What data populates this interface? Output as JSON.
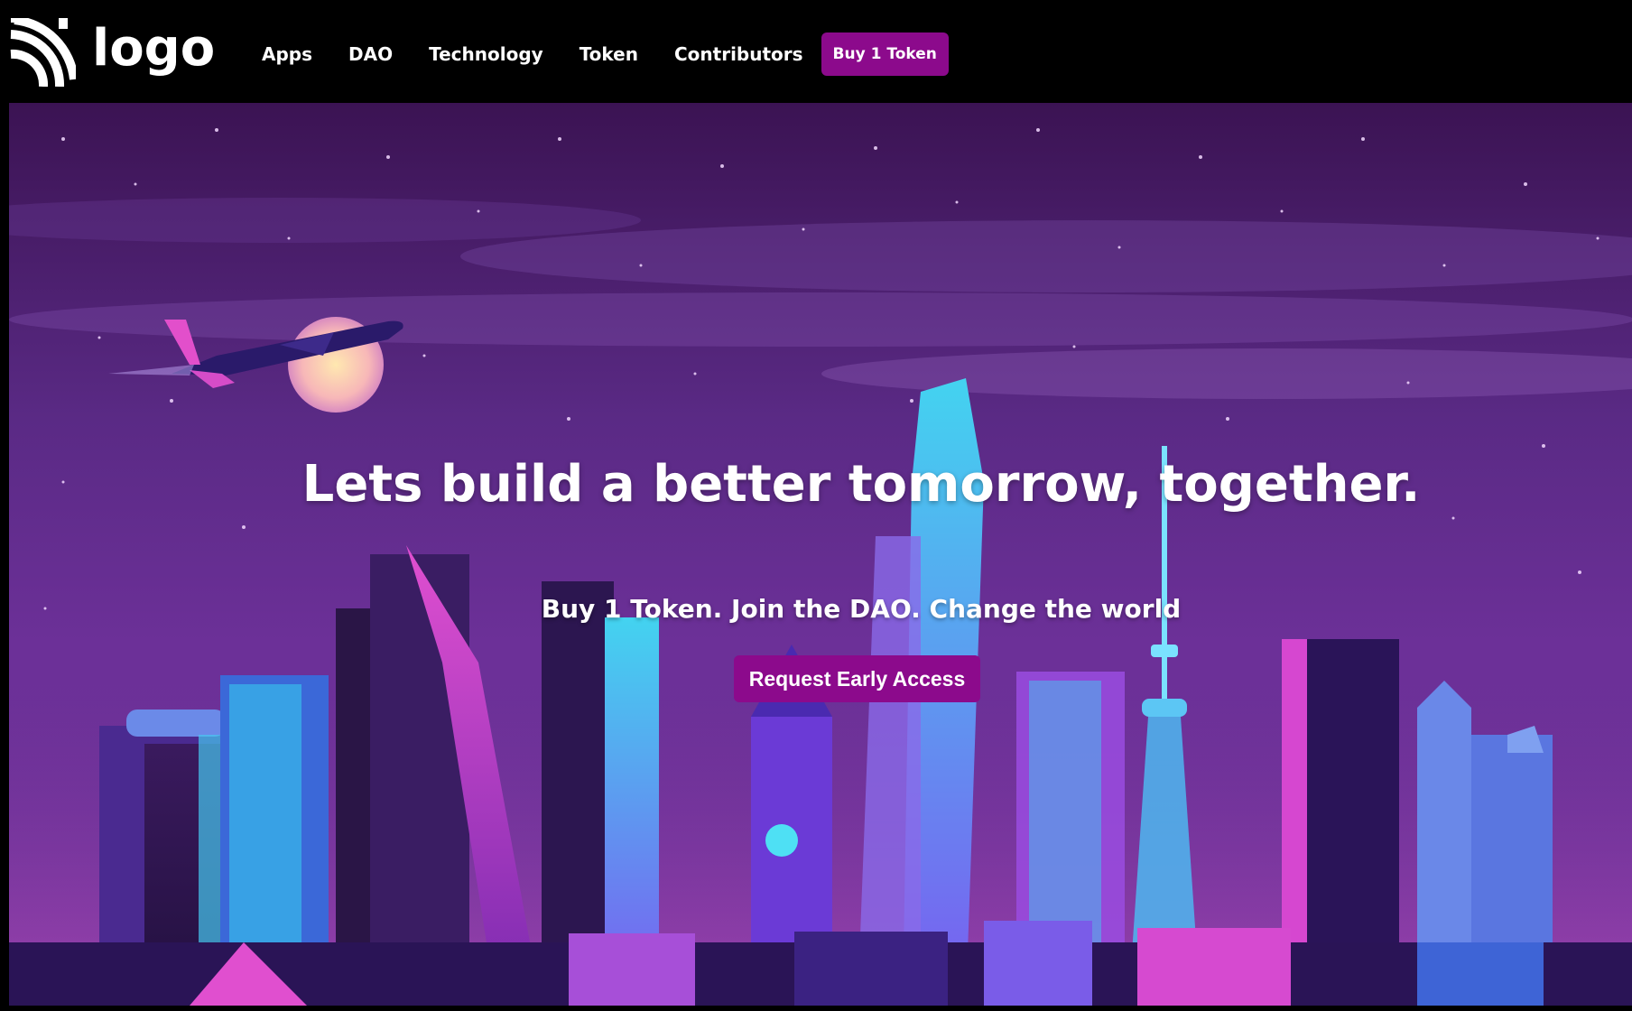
{
  "header": {
    "logo_text": "logo",
    "logo_icon": "wifi-signal-icon",
    "nav": [
      {
        "label": "Apps"
      },
      {
        "label": "DAO"
      },
      {
        "label": "Technology"
      },
      {
        "label": "Token"
      },
      {
        "label": "Contributors"
      }
    ],
    "cta_label": "Buy 1 Token"
  },
  "hero": {
    "title": "Lets build a better tomorrow, together.",
    "subtitle": "Buy 1 Token. Join the DAO. Change the world",
    "cta_label": "Request Early Access",
    "background_image": "neon-city-skyline-illustration"
  },
  "colors": {
    "accent": "#8c0a8c",
    "header_bg": "#000000",
    "text": "#ffffff"
  }
}
